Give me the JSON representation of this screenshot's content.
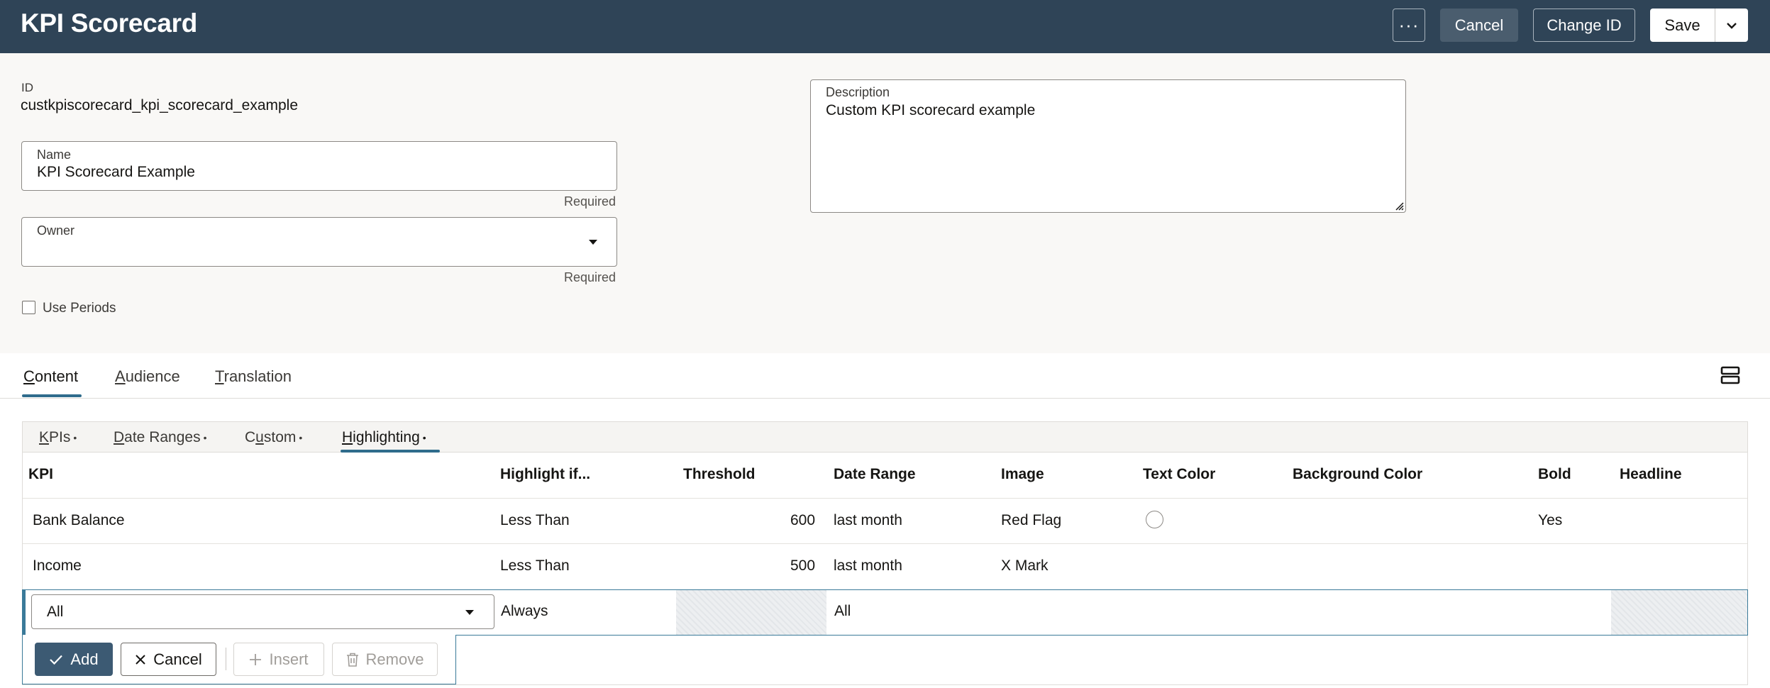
{
  "header": {
    "title": "KPI Scorecard",
    "more_label": "···",
    "cancel_label": "Cancel",
    "change_id_label": "Change ID",
    "save_label": "Save"
  },
  "form": {
    "id_label": "ID",
    "id_value": "custkpiscorecard_kpi_scorecard_example",
    "name_label": "Name",
    "name_value": "KPI Scorecard Example",
    "name_required": "Required",
    "owner_label": "Owner",
    "owner_value": "",
    "owner_required": "Required",
    "use_periods_label": "Use Periods",
    "use_periods_checked": false,
    "description_label": "Description",
    "description_value": "Custom KPI scorecard example"
  },
  "tabs": {
    "content": {
      "u": "C",
      "rest": "ontent"
    },
    "audience": {
      "u": "A",
      "rest": "udience"
    },
    "translation": {
      "u": "T",
      "rest": "ranslation"
    }
  },
  "subtabs": {
    "kpis": {
      "u": "K",
      "rest": "PIs"
    },
    "date_ranges": {
      "u": "D",
      "rest": "ate Ranges"
    },
    "custom": {
      "pre": "C",
      "u": "u",
      "rest": "stom"
    },
    "highlighting": {
      "u": "H",
      "rest": "ighlighting"
    },
    "dot": "•"
  },
  "table": {
    "columns": [
      "KPI",
      "Highlight if...",
      "Threshold",
      "Date Range",
      "Image",
      "Text Color",
      "Background Color",
      "Bold",
      "Headline"
    ],
    "rows": [
      {
        "kpi": "Bank Balance",
        "highlight_if": "Less Than",
        "threshold": "600",
        "date_range": "last month",
        "image": "Red Flag",
        "text_color": "",
        "background_color": "",
        "bold": "Yes",
        "headline": ""
      },
      {
        "kpi": "Income",
        "highlight_if": "Less Than",
        "threshold": "500",
        "date_range": "last month",
        "image": "X Mark",
        "text_color": "",
        "background_color": "",
        "bold": "",
        "headline": ""
      }
    ],
    "edit_row": {
      "kpi": "All",
      "highlight_if": "Always",
      "date_range": "All"
    }
  },
  "row_actions": {
    "add": "Add",
    "cancel": "Cancel",
    "insert": "Insert",
    "remove": "Remove"
  },
  "colors": {
    "header_bg": "#2f4457",
    "accent": "#2f6c8c",
    "add_button_bg": "#3c5a73"
  }
}
